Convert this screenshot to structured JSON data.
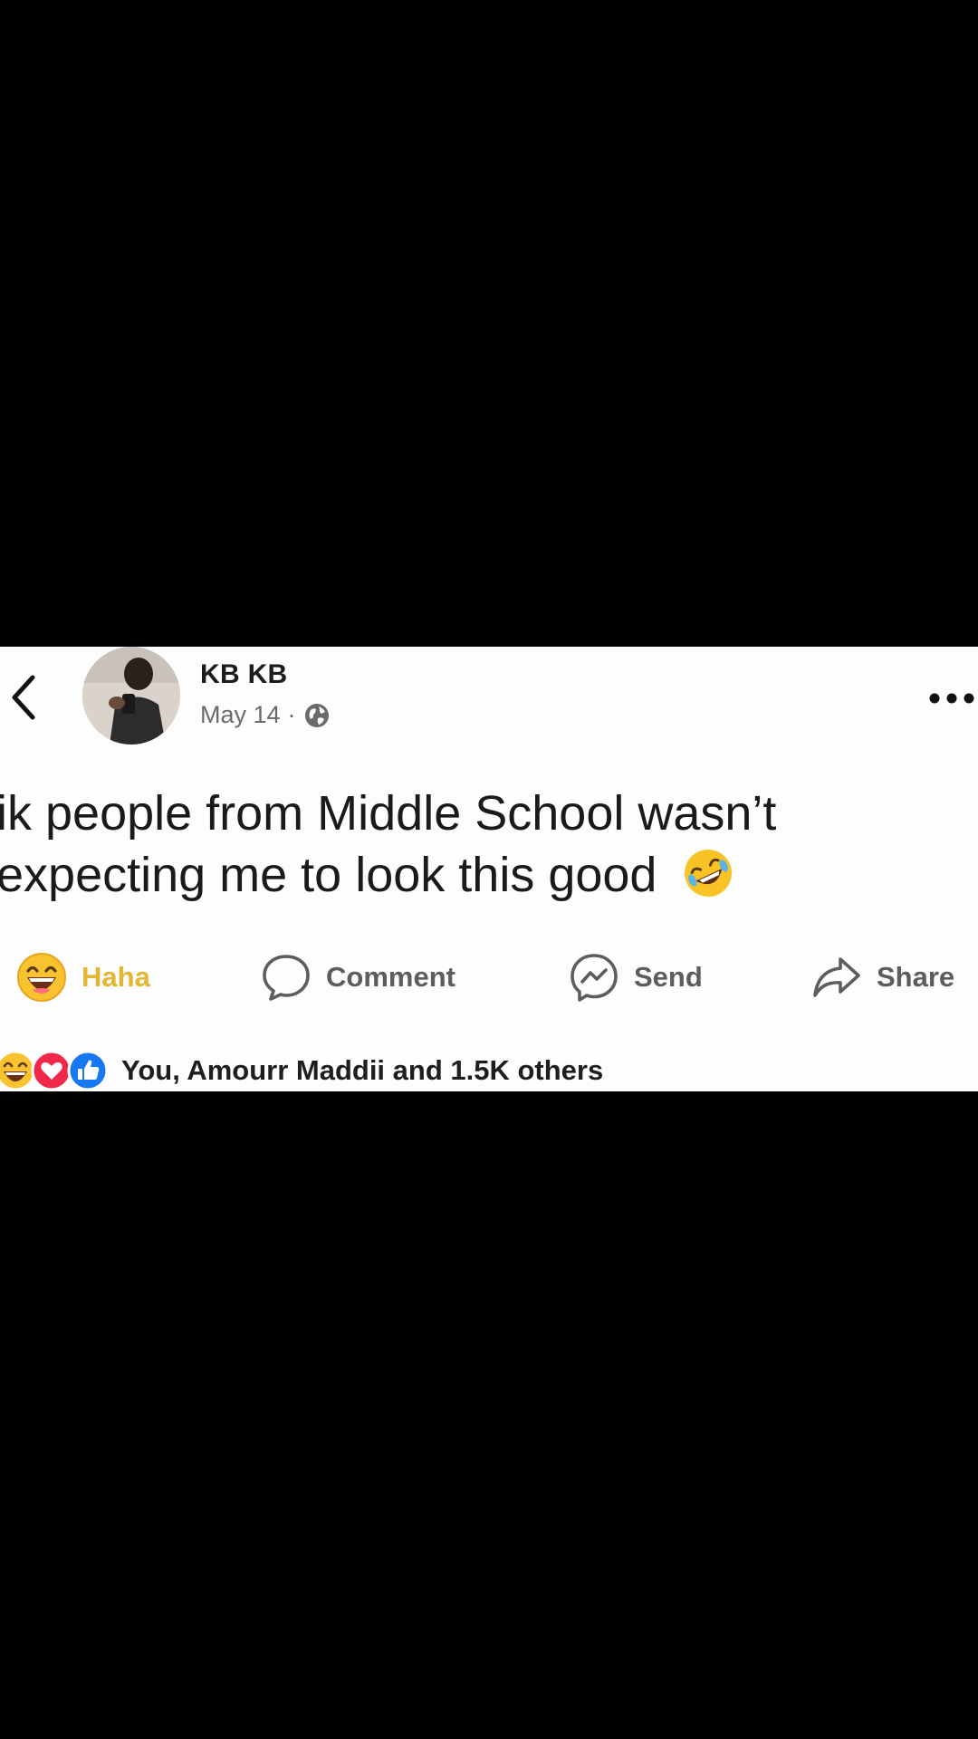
{
  "post": {
    "author": "KB KB",
    "date": "May 14",
    "separator": "·",
    "privacy_icon": "globe-icon",
    "text_lines": [
      "ik people from Middle School wasn’t",
      "expecting me to look this good"
    ],
    "text_emoji": "rolling-on-floor-laughing-emoji"
  },
  "actions": {
    "haha": "Haha",
    "comment": "Comment",
    "send": "Send",
    "share": "Share"
  },
  "reactions": {
    "icons": [
      "haha-icon",
      "love-icon",
      "like-icon"
    ],
    "summary": "You, Amourr Maddii and 1.5K others"
  },
  "colors": {
    "haha_active": "#e2b633",
    "like_blue": "#1877f2",
    "love_red": "#f0284a",
    "background": "#000000",
    "card": "#fdfdfd"
  }
}
